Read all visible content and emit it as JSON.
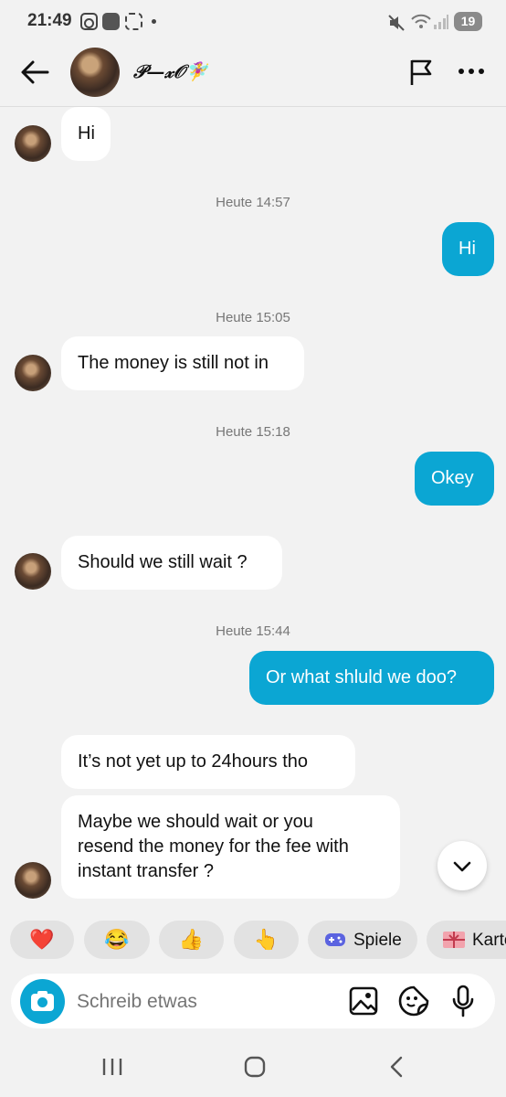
{
  "status_bar": {
    "time": "21:49",
    "battery": "19"
  },
  "header": {
    "contact_name": "𝒫—𝓍𝒪🧚‍♀️"
  },
  "messages": [
    {
      "type": "incoming",
      "text": "Hi"
    },
    {
      "type": "timestamp",
      "text": "Heute 14:57"
    },
    {
      "type": "outgoing",
      "text": "Hi"
    },
    {
      "type": "timestamp",
      "text": "Heute 15:05"
    },
    {
      "type": "incoming",
      "text": "The money is still not in"
    },
    {
      "type": "timestamp",
      "text": "Heute 15:18"
    },
    {
      "type": "outgoing",
      "text": "Okey"
    },
    {
      "type": "incoming",
      "text": "Should we still wait ?"
    },
    {
      "type": "timestamp",
      "text": "Heute 15:44"
    },
    {
      "type": "outgoing",
      "text": "Or what shluld we doo?"
    },
    {
      "type": "incoming",
      "text": "It’s not yet up to 24hours tho"
    },
    {
      "type": "incoming",
      "lines": [
        "Maybe we should wait or you",
        "resend the money for the fee with",
        "instant transfer ?"
      ]
    }
  ],
  "reactions": {
    "heart": "❤️",
    "laugh": "😂",
    "thumbs_up": "👍",
    "point": "👆",
    "games_label": "Spiele",
    "cards_label": "Karte"
  },
  "composer": {
    "placeholder": "Schreib etwas"
  },
  "colors": {
    "accent": "#0ba6d3",
    "background": "#f2f2f2",
    "bubble_in": "#ffffff"
  }
}
